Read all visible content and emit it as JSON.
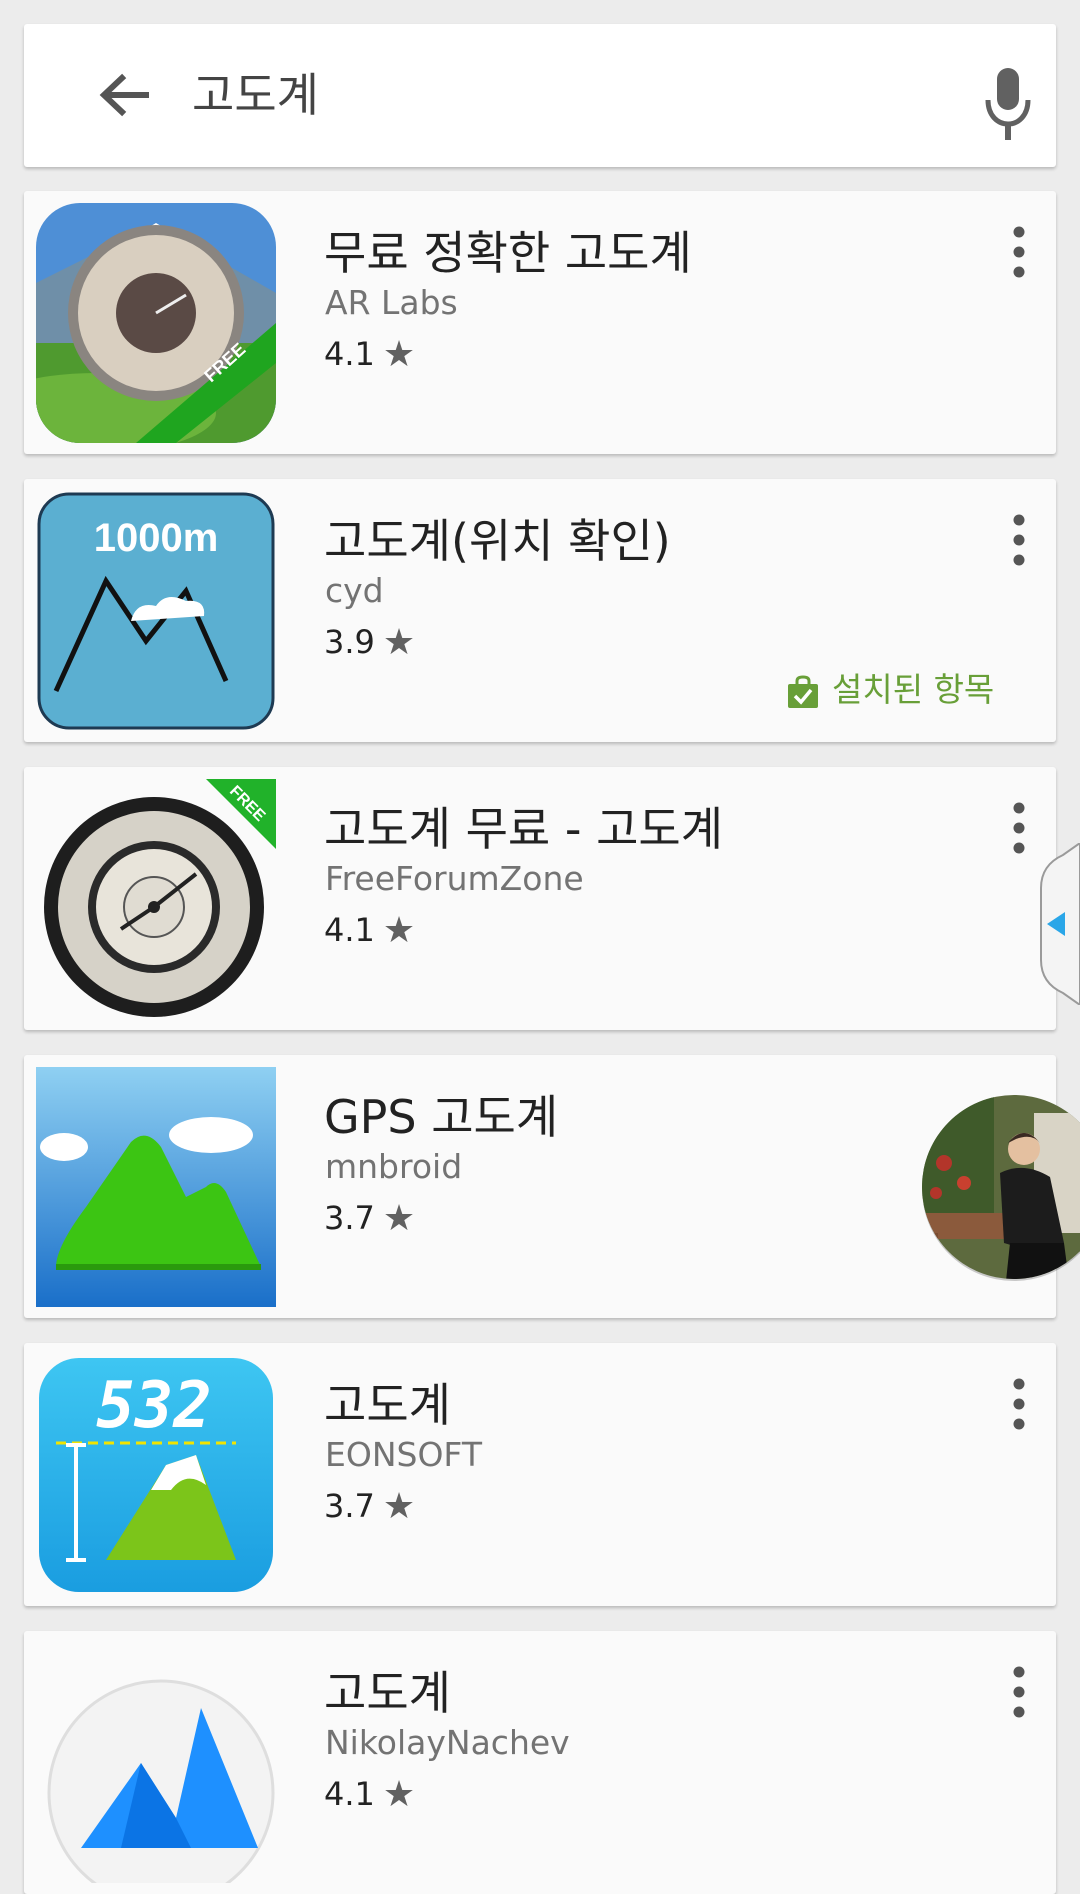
{
  "search": {
    "query": "고도계"
  },
  "apps": [
    {
      "title": "무료 정확한 고도계",
      "developer": "AR Labs",
      "rating": "4.1",
      "installed": false,
      "icon": "altimeter-gauge-free-icon"
    },
    {
      "title": "고도계(위치 확인)",
      "developer": "cyd",
      "rating": "3.9",
      "installed": true,
      "installed_label": "설치된 항목",
      "icon": "mountain-1000m-icon"
    },
    {
      "title": "고도계 무료 - 고도계",
      "developer": "FreeForumZone",
      "rating": "4.1",
      "installed": false,
      "icon": "altimeter-dial-free-icon"
    },
    {
      "title": "GPS 고도계",
      "developer": "mnbroid",
      "rating": "3.7",
      "installed": false,
      "icon": "green-hills-icon"
    },
    {
      "title": "고도계",
      "developer": "EONSOFT",
      "rating": "3.7",
      "installed": false,
      "icon": "digital-532-mountain-icon"
    },
    {
      "title": "고도계",
      "developer": "NikolayNachev",
      "rating": "4.1",
      "installed": false,
      "icon": "blue-peaks-icon"
    }
  ],
  "icon_labels": {
    "app0_badge": "FREE",
    "app1_height": "1000m",
    "app2_badge": "FREE",
    "app4_digits": "532"
  },
  "colors": {
    "installed_green": "#689f38",
    "card_bg": "#fafafa",
    "page_bg": "#ececec"
  }
}
